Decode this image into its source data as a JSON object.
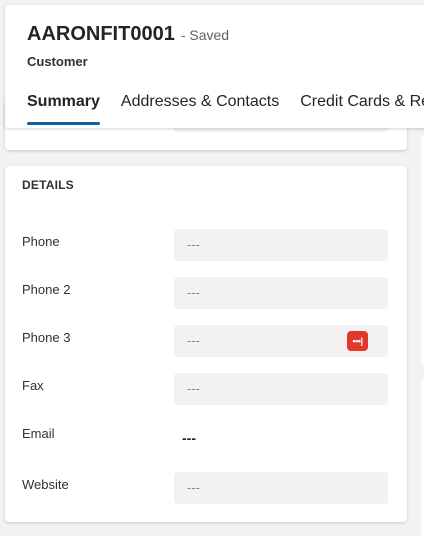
{
  "header": {
    "record_title": "AARONFIT0001",
    "save_status": "- Saved",
    "entity_type": "Customer"
  },
  "tabs": [
    {
      "label": "Summary",
      "selected": true
    },
    {
      "label": "Addresses & Contacts",
      "selected": false
    },
    {
      "label": "Credit Cards & Rel",
      "selected": false
    }
  ],
  "details": {
    "section_title": "DETAILS",
    "fields": {
      "phone": {
        "label": "Phone",
        "value": "---"
      },
      "phone2": {
        "label": "Phone 2",
        "value": "---"
      },
      "phone3": {
        "label": "Phone 3",
        "value": "---",
        "icon": "password-manager-icon"
      },
      "fax": {
        "label": "Fax",
        "value": "---"
      },
      "email": {
        "label": "Email",
        "value": "---"
      },
      "website": {
        "label": "Website",
        "value": "---"
      }
    }
  },
  "colors": {
    "accent": "#115ea3",
    "icon_red": "#e3372b",
    "field_bg": "#f3f2f1"
  }
}
